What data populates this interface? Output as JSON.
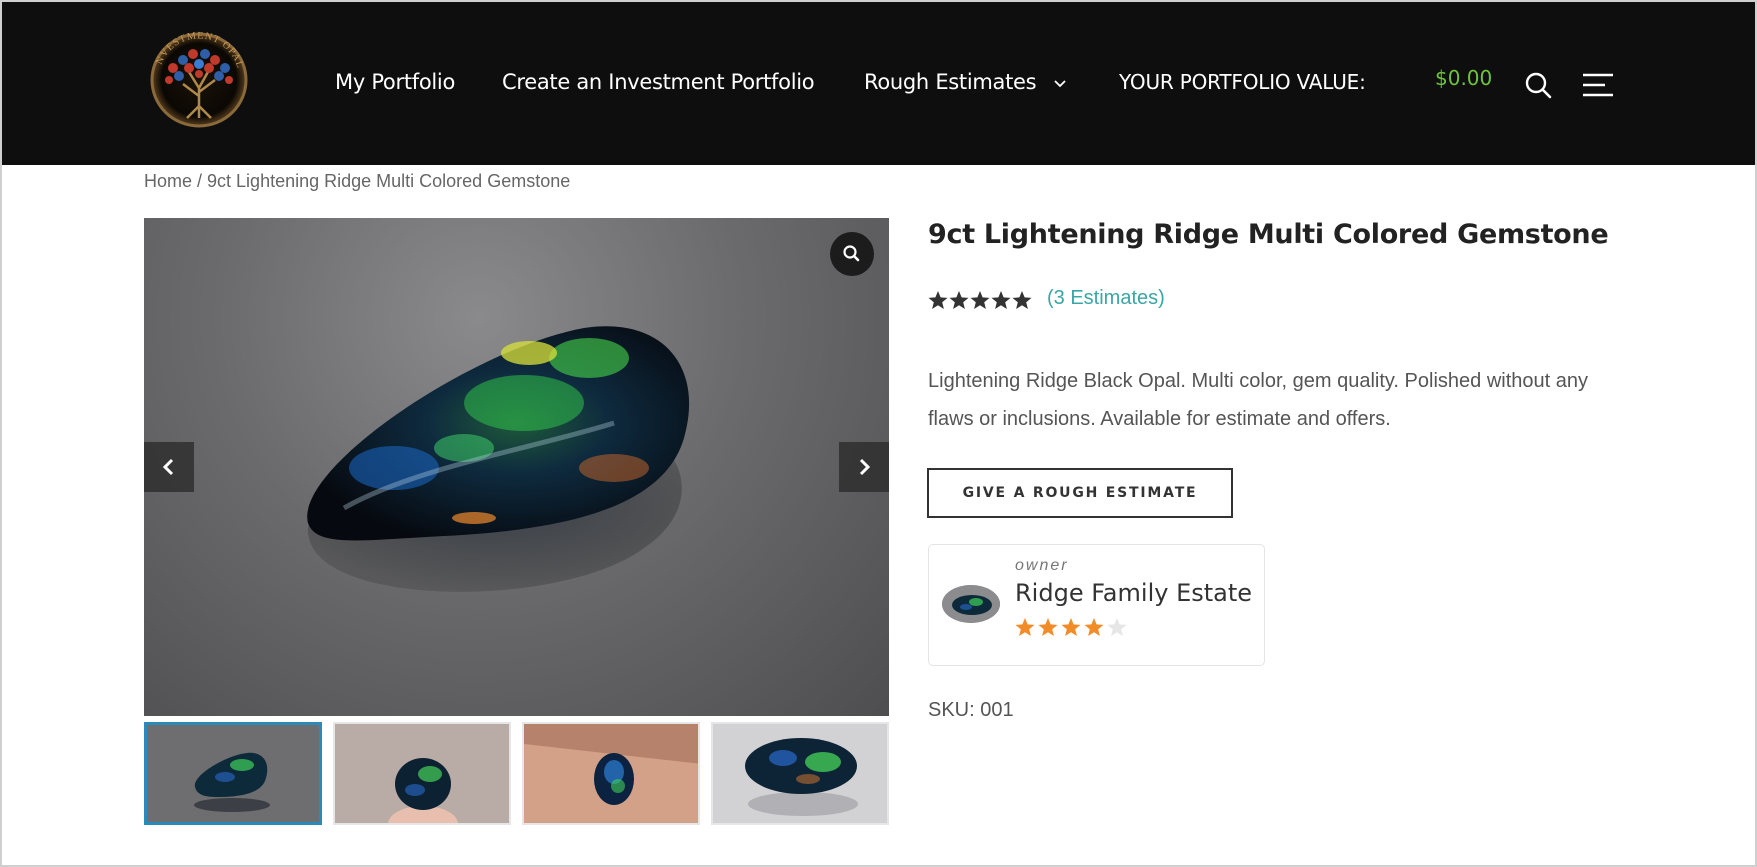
{
  "brand": {
    "logo_text": "INVESTMENT OPAL",
    "logo_icon": "opal-tree-logo-icon"
  },
  "nav": {
    "items": [
      {
        "label": "My Portfolio"
      },
      {
        "label": "Create an Investment Portfolio"
      },
      {
        "label": "Rough Estimates",
        "has_dropdown": true
      }
    ],
    "portfolio_value_label": "YOUR PORTFOLIO VALUE:",
    "portfolio_value": "$0.00",
    "search_icon": "search-icon",
    "menu_icon": "menu-icon"
  },
  "breadcrumb": {
    "home": "Home",
    "separator": " / ",
    "current": "9ct Lightening Ridge Multi Colored Gemstone"
  },
  "gallery": {
    "zoom_icon": "zoom-icon",
    "prev_icon": "chevron-left-icon",
    "next_icon": "chevron-right-icon",
    "thumbnail_count": 4,
    "active_thumbnail": 1
  },
  "product": {
    "title": "9ct Lightening Ridge Multi Colored Gemstone",
    "rating": 5,
    "reviews_link": "(3 Estimates)",
    "description": "Lightening Ridge Black Opal. Multi color, gem quality. Polished without any flaws or inclusions. Available for estimate and offers.",
    "button_label": "GIVE A ROUGH ESTIMATE",
    "sku": "SKU: 001"
  },
  "owner": {
    "kicker": "owner",
    "name": "Ridge Family Estate",
    "rating": 4
  },
  "colors": {
    "header_bg": "#0e0e0e",
    "value_green": "#6dc43b",
    "link_teal": "#3aa6a6",
    "star_dark": "#333333",
    "star_orange": "#f28c28",
    "thumb_active_border": "#2a8ab8"
  }
}
